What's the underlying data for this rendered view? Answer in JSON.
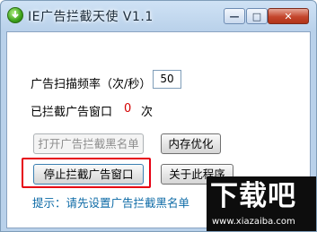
{
  "window": {
    "title": "IE广告拦截天使 V1.1",
    "minimize_glyph": "—",
    "maximize_glyph": "□",
    "close_glyph": "✕",
    "app_icon": "download-arrow-icon"
  },
  "main": {
    "frequency_label": "广告扫描频率（次/秒）",
    "frequency_value": "50",
    "blocked_label": "已拦截广告窗口",
    "blocked_count": "0",
    "blocked_unit": "次"
  },
  "buttons": {
    "open_blacklist": "打开广告拦截黑名单",
    "optimize_memory": "内存优化",
    "stop_blocking": "停止拦截广告窗口",
    "about": "关于此程序"
  },
  "hint": "提示：请先设置广告拦截黑名单",
  "watermark": {
    "logo": "下载吧",
    "url": "www.xiazaiba.com"
  },
  "colors": {
    "highlight": "#e60012",
    "hint": "#0c6aa6",
    "count": "#d40000"
  }
}
